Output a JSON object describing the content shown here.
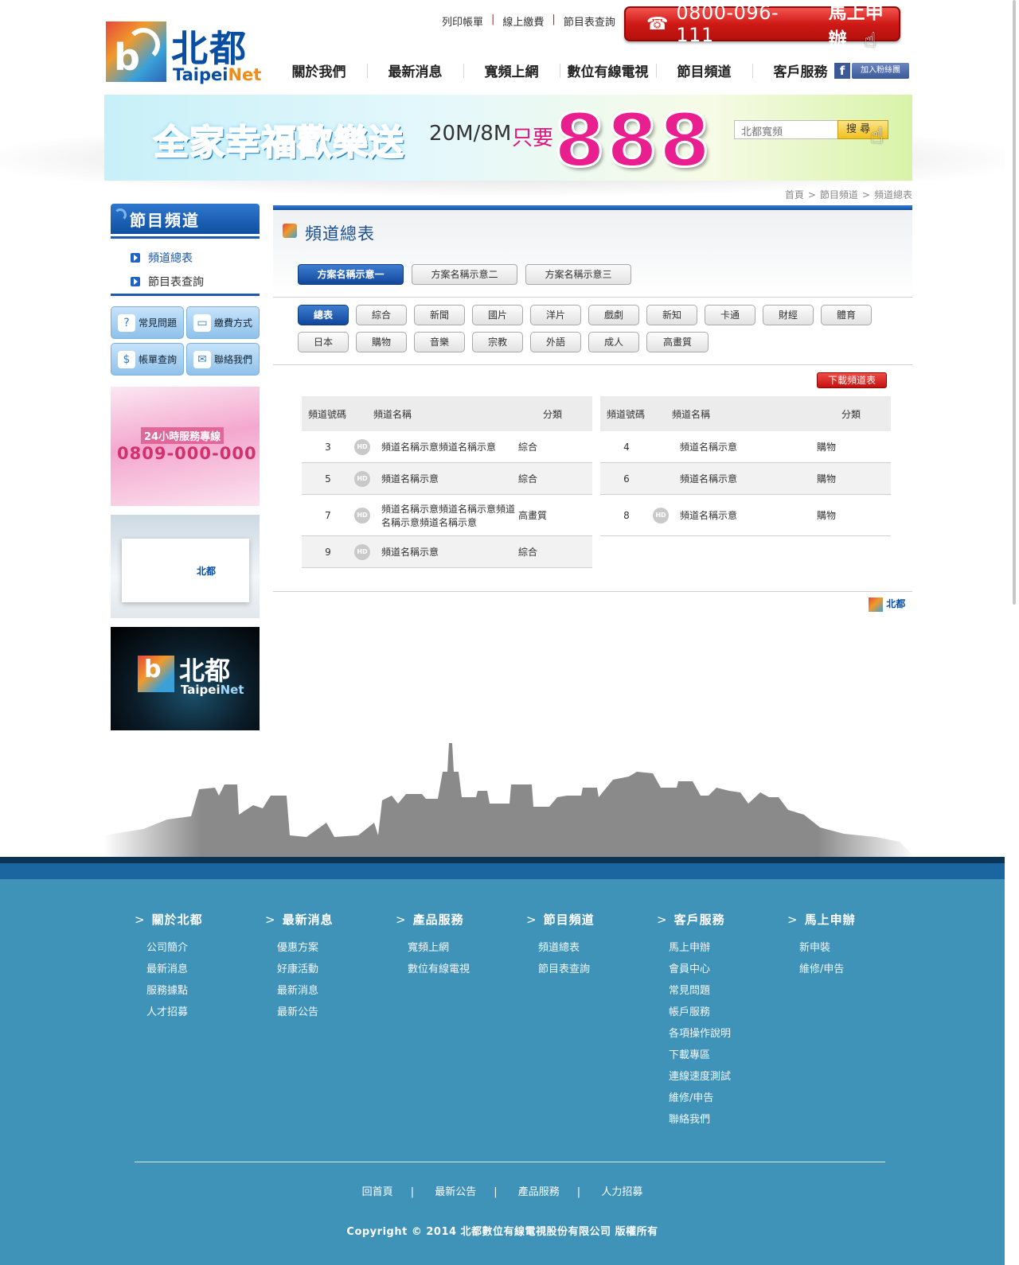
{
  "logo": {
    "name_cn": "北都",
    "name_en_a": "Taipei",
    "name_en_b": "Net"
  },
  "top_links": [
    "列印帳單",
    "線上繳費",
    "節目表查詢"
  ],
  "hotline": {
    "number": "0800-096-111",
    "action": "馬上申辦"
  },
  "nav": [
    "關於我們",
    "最新消息",
    "寬頻上網",
    "數位有線電視",
    "節目頻道",
    "客戶服務"
  ],
  "fans_label": "加入粉絲團",
  "banner": {
    "slogan": "全家幸福歡樂送",
    "speed": "20M/8M",
    "only": "只要",
    "price": "888"
  },
  "search": {
    "placeholder": "北都寬頻",
    "button": "搜 尋"
  },
  "breadcrumb": [
    "首頁",
    "節目頻道",
    "頻道總表"
  ],
  "sidebar": {
    "title": "節目頻道",
    "items": [
      "頻道總表",
      "節目表查詢"
    ],
    "quick": [
      "常見問題",
      "繳費方式",
      "帳單查詢",
      "聯絡我們"
    ],
    "promo_label": "24小時服務專線",
    "promo_tel": "0809-000-000"
  },
  "main": {
    "title": "頻道總表",
    "plans": [
      "方案名稱示意一",
      "方案名稱示意二",
      "方案名稱示意三"
    ],
    "categories": [
      "總表",
      "綜合",
      "新聞",
      "國片",
      "洋片",
      "戲劇",
      "新知",
      "卡通",
      "財經",
      "體育",
      "日本",
      "購物",
      "音樂",
      "宗教",
      "外語",
      "成人",
      "高畫質"
    ],
    "download": "下載頻道表",
    "headers": {
      "num": "頻道號碼",
      "name": "頻道名稱",
      "cat": "分類"
    },
    "hd_label": "HD",
    "left_rows": [
      {
        "num": "3",
        "name": "頻道名稱示意頻道名稱示意",
        "cat": "綜合"
      },
      {
        "num": "5",
        "name": "頻道名稱示意",
        "cat": "綜合"
      },
      {
        "num": "7",
        "name": "頻道名稱示意頻道名稱示意頻道名稱示意頻道名稱示意",
        "cat": "高畫質"
      },
      {
        "num": "9",
        "name": "頻道名稱示意",
        "cat": "綜合"
      }
    ],
    "right_rows": [
      {
        "num": "4",
        "name": "頻道名稱示意",
        "cat": "購物"
      },
      {
        "num": "6",
        "name": "頻道名稱示意",
        "cat": "購物"
      },
      {
        "num": "8",
        "name": "頻道名稱示意",
        "cat": "購物"
      }
    ]
  },
  "footer": {
    "columns": [
      {
        "title": "關於北都",
        "links": [
          "公司簡介",
          "最新消息",
          "服務據點",
          "人才招募"
        ]
      },
      {
        "title": "最新消息",
        "links": [
          "優惠方案",
          "好康活動",
          "最新消息",
          "最新公告"
        ]
      },
      {
        "title": "產品服務",
        "links": [
          "寬頻上網",
          "數位有線電視"
        ]
      },
      {
        "title": "節目頻道",
        "links": [
          "頻道總表",
          "節目表查詢"
        ]
      },
      {
        "title": "客戶服務",
        "links": [
          "馬上申辦",
          "會員中心",
          "常見問題",
          "帳戶服務",
          "各項操作說明",
          "下載專區",
          "連線速度測試",
          "維修/申告",
          "聯絡我們"
        ]
      },
      {
        "title": "馬上申辦",
        "links": [
          "新申裝",
          "維修/申告"
        ]
      }
    ],
    "bottom_links": [
      "回首頁",
      "最新公告",
      "產品服務",
      "人力招募"
    ],
    "copyright": "Copyright © 2014 北都數位有線電視股份有限公司 版權所有"
  }
}
